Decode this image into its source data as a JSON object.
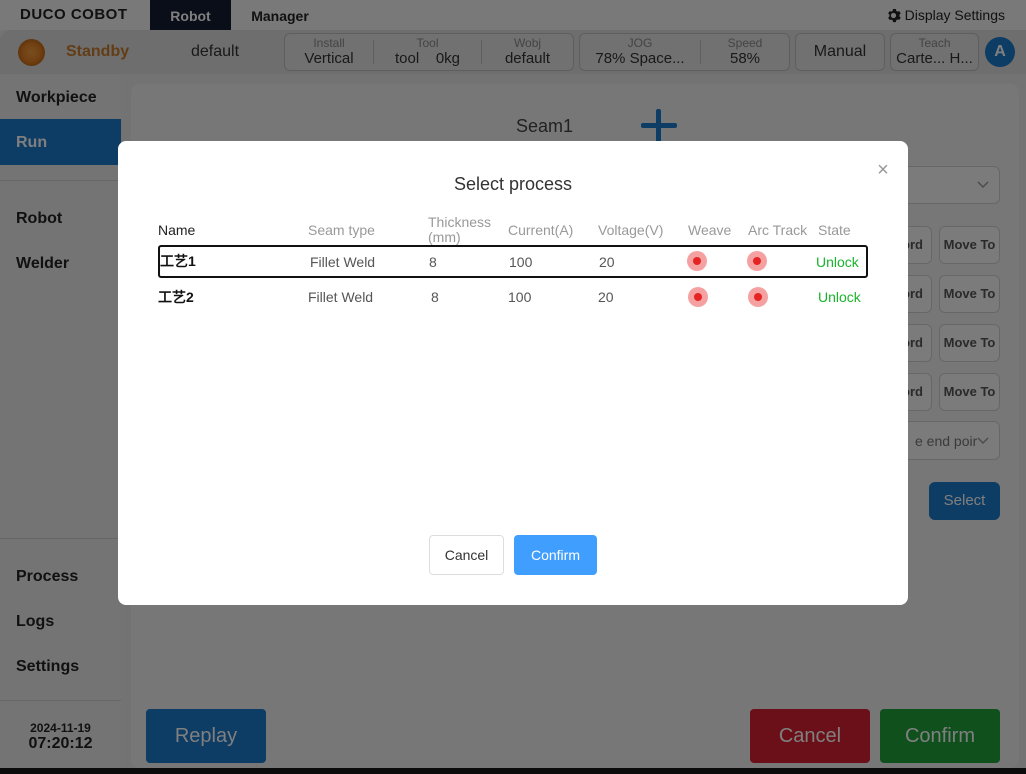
{
  "topbar": {
    "logo": "DUCO COBOT",
    "tabs": [
      {
        "label": "Robot"
      },
      {
        "label": "Manager"
      }
    ],
    "display_settings": "Display Settings"
  },
  "status": {
    "state": "Standby",
    "program": "default",
    "install": {
      "label": "Install",
      "value": "Vertical"
    },
    "tool": {
      "label": "Tool",
      "value": "tool",
      "load": "0kg"
    },
    "wobj": {
      "label": "Wobj",
      "value": "default"
    },
    "jog": {
      "label": "JOG",
      "value": "78%  Space..."
    },
    "speed": {
      "label": "Speed",
      "value": "58%"
    },
    "mode": "Manual",
    "teach": {
      "label": "Teach",
      "value": "Carte... H..."
    },
    "user_initial": "A"
  },
  "sidebar": {
    "items": [
      {
        "label": "Workpiece"
      },
      {
        "label": "Run"
      },
      {
        "label": "Robot"
      },
      {
        "label": "Welder"
      },
      {
        "label": "Process"
      },
      {
        "label": "Logs"
      },
      {
        "label": "Settings"
      }
    ],
    "date": "2024-11-19",
    "time": "07:20:12"
  },
  "main": {
    "seam_title": "Seam1",
    "record_partial": "ord",
    "move_to": "Move To",
    "end_point_partial": "e end poir",
    "select_label": "Select",
    "replay": "Replay",
    "cancel": "Cancel",
    "confirm": "Confirm"
  },
  "modal": {
    "title": "Select process",
    "close": "×",
    "columns": [
      "Name",
      "Seam type",
      "Thickness (mm)",
      "Current(A)",
      "Voltage(V)",
      "Weave",
      "Arc Track",
      "State"
    ],
    "rows": [
      {
        "name": "工艺1",
        "seam_type": "Fillet Weld",
        "thickness": "8",
        "current": "100",
        "voltage": "20",
        "weave": true,
        "arc_track": true,
        "state": "Unlock"
      },
      {
        "name": "工艺2",
        "seam_type": "Fillet Weld",
        "thickness": "8",
        "current": "100",
        "voltage": "20",
        "weave": true,
        "arc_track": true,
        "state": "Unlock"
      }
    ],
    "cancel": "Cancel",
    "confirm": "Confirm"
  }
}
